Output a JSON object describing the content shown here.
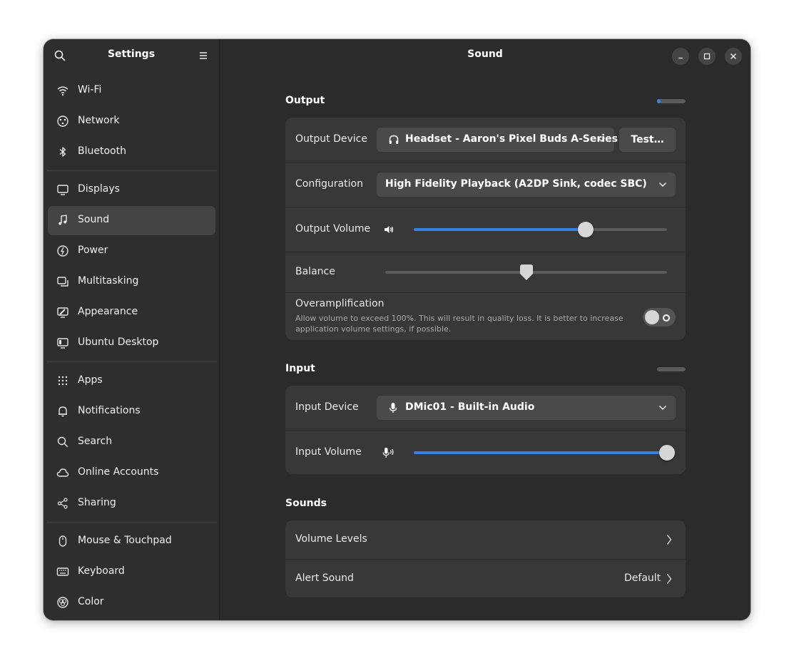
{
  "sidebar": {
    "title": "Settings",
    "groups": [
      [
        {
          "label": "Wi-Fi",
          "icon": "wifi-icon"
        },
        {
          "label": "Network",
          "icon": "network-icon"
        },
        {
          "label": "Bluetooth",
          "icon": "bluetooth-icon"
        }
      ],
      [
        {
          "label": "Displays",
          "icon": "display-icon"
        },
        {
          "label": "Sound",
          "icon": "music-note-icon",
          "active": true
        },
        {
          "label": "Power",
          "icon": "power-icon"
        },
        {
          "label": "Multitasking",
          "icon": "multitasking-icon"
        },
        {
          "label": "Appearance",
          "icon": "appearance-icon"
        },
        {
          "label": "Ubuntu Desktop",
          "icon": "ubuntu-desktop-icon"
        }
      ],
      [
        {
          "label": "Apps",
          "icon": "apps-grid-icon"
        },
        {
          "label": "Notifications",
          "icon": "bell-icon"
        },
        {
          "label": "Search",
          "icon": "search-icon"
        },
        {
          "label": "Online Accounts",
          "icon": "cloud-icon"
        },
        {
          "label": "Sharing",
          "icon": "share-icon"
        }
      ],
      [
        {
          "label": "Mouse & Touchpad",
          "icon": "mouse-icon"
        },
        {
          "label": "Keyboard",
          "icon": "keyboard-icon"
        },
        {
          "label": "Color",
          "icon": "color-icon"
        }
      ]
    ]
  },
  "main": {
    "title": "Sound",
    "output": {
      "title": "Output",
      "level": 0.12,
      "device_label": "Output Device",
      "device_value": "Headset - Aaron's Pixel Buds A-Series",
      "test_label": "Test…",
      "config_label": "Configuration",
      "config_value": "High Fidelity Playback (A2DP Sink, codec SBC)",
      "volume_label": "Output Volume",
      "volume_value": 0.68,
      "balance_label": "Balance",
      "balance_value": 0.5,
      "overamp_label": "Overamplification",
      "overamp_desc": "Allow volume to exceed 100%. This will result in quality loss. It is better to increase application volume settings, if possible.",
      "overamp_on": false
    },
    "input": {
      "title": "Input",
      "level": 0.0,
      "device_label": "Input Device",
      "device_value": "DMic01 - Built-in Audio",
      "volume_label": "Input Volume",
      "volume_value": 1.0
    },
    "sounds": {
      "title": "Sounds",
      "volume_levels_label": "Volume Levels",
      "alert_label": "Alert Sound",
      "alert_value": "Default"
    }
  },
  "colors": {
    "accent": "#3584e4",
    "window_bg": "#2b2b2b",
    "card_bg": "#383838"
  }
}
